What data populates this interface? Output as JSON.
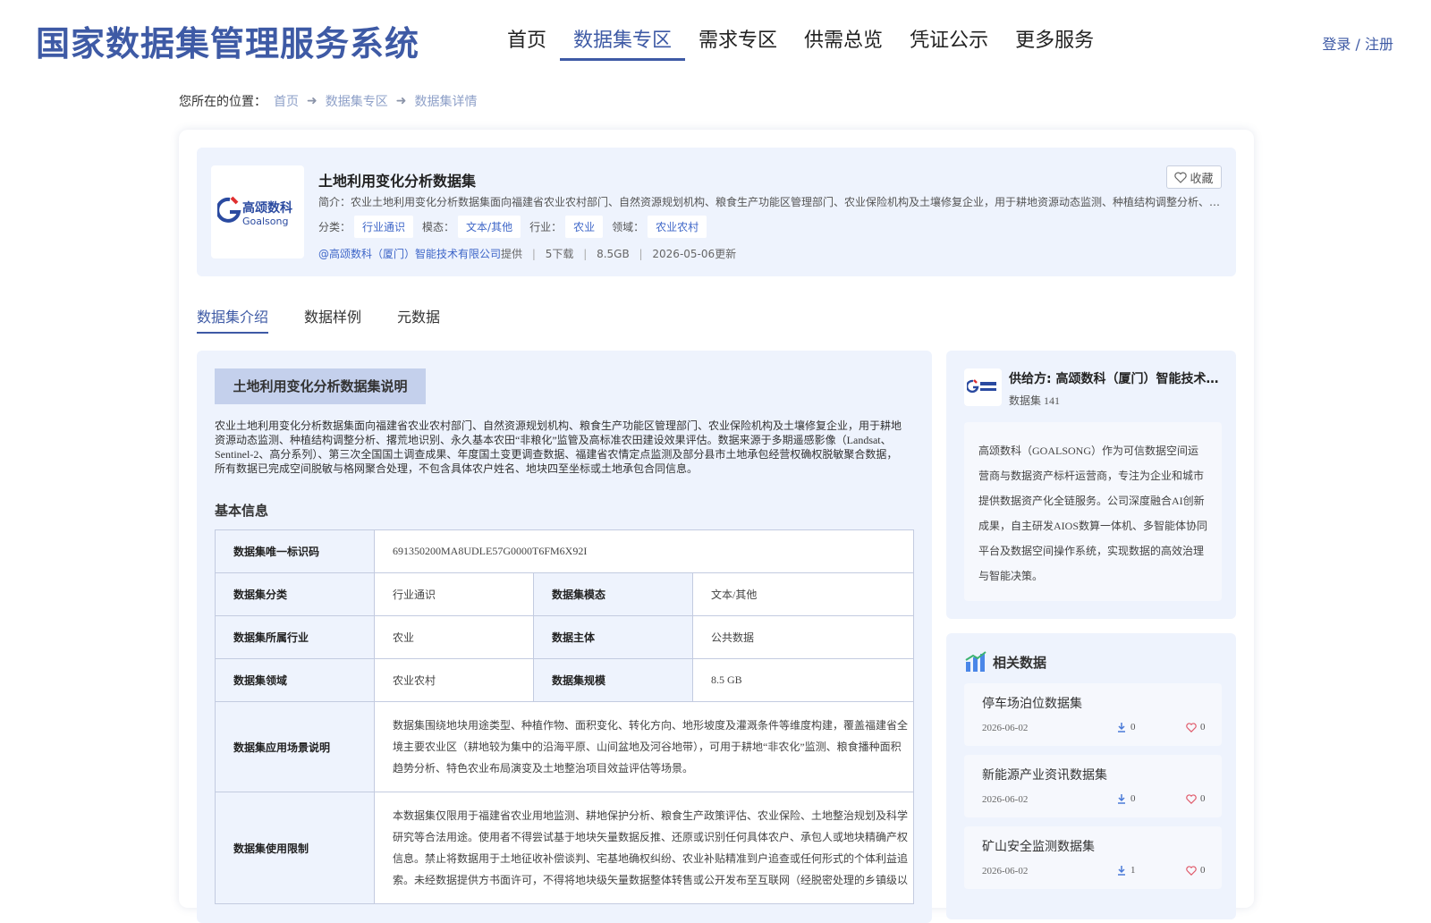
{
  "header": {
    "site_title": "国家数据集管理服务系统",
    "nav": [
      "首页",
      "数据集专区",
      "需求专区",
      "供需总览",
      "凭证公示",
      "更多服务"
    ],
    "login": "登录 / 注册"
  },
  "breadcrumb": {
    "prefix": "您所在的位置：",
    "items": [
      "首页",
      "数据集专区",
      "数据集详情"
    ]
  },
  "dataset": {
    "title": "土地利用变化分析数据集",
    "summary": "简介：农业土地利用变化分析数据集面向福建省农业农村部门、自然资源规划机构、粮食生产功能区管理部门、农业保险机构及土壤修复企业，用于耕地资源动态监测、种植结构调整分析、撂荒地识别、永久基本农田“非粮化”监管及高标准农田建设效果评估。",
    "tags": [
      {
        "label": "分类：",
        "value": "行业通识"
      },
      {
        "label": "模态：",
        "value": "文本/其他"
      },
      {
        "label": "行业：",
        "value": "农业"
      },
      {
        "label": "领域：",
        "value": "农业农村"
      }
    ],
    "provider": "@高颂数科（厦门）智能技术有限公司",
    "provider_suffix": "提供",
    "downloads": "5下载",
    "size": "8.5GB",
    "updated": "2026-05-06更新",
    "favorite": "收藏",
    "logo_cn": "高颂数科",
    "logo_en": "Goalsong"
  },
  "tabs": [
    "数据集介绍",
    "数据样例",
    "元数据"
  ],
  "intro": {
    "section_title": "土地利用变化分析数据集说明",
    "description": "农业土地利用变化分析数据集面向福建省农业农村部门、自然资源规划机构、粮食生产功能区管理部门、农业保险机构及土壤修复企业，用于耕地资源动态监测、种植结构调整分析、撂荒地识别、永久基本农田“非粮化”监管及高标准农田建设效果评估。数据来源于多期遥感影像（Landsat、Sentinel-2、高分系列）、第三次全国国土调查成果、年度国土变更调查数据、福建省农情定点监测及部分县市土地承包经营权确权脱敏聚合数据，所有数据已完成空间脱敏与格网聚合处理，不包含具体农户姓名、地块四至坐标或土地承包合同信息。",
    "basic_title": "基本信息",
    "rows": {
      "id_label": "数据集唯一标识码",
      "id_value": "691350200MA8UDLE57G0000T6FM6X92I",
      "category_label": "数据集分类",
      "category_value": "行业通识",
      "modality_label": "数据集模态",
      "modality_value": "文本/其他",
      "industry_label": "数据集所属行业",
      "industry_value": "农业",
      "subject_label": "数据主体",
      "subject_value": "公共数据",
      "domain_label": "数据集领域",
      "domain_value": "农业农村",
      "scale_label": "数据集规模",
      "scale_value": "8.5 GB",
      "scenario_label": "数据集应用场景说明",
      "scenario_value": "数据集围绕地块用途类型、种植作物、面积变化、转化方向、地形坡度及灌溉条件等维度构建，覆盖福建省全境主要农业区（耕地较为集中的沿海平原、山间盆地及河谷地带），可用于耕地“非农化”监测、粮食播种面积趋势分析、特色农业布局演变及土地整治项目效益评估等场景。",
      "limit_label": "数据集使用限制",
      "limit_value": "本数据集仅限用于福建省农业用地监测、耕地保护分析、粮食生产政策评估、农业保险、土地整治规划及科学研究等合法用途。使用者不得尝试基于地块矢量数据反推、还原或识别任何具体农户、承包人或地块精确产权信息。禁止将数据用于土地征收补偿谈判、宅基地确权纠纷、农业补贴精准到户追查或任何形式的个体利益追索。未经数据提供方书面许可，不得将地块级矢量数据整体转售或公开发布至互联网（经脱密处理的乡镇级以"
    }
  },
  "sidebar": {
    "provider": "供给方: 高颂数科（厦门）智能技术有限公司",
    "dataset_count": "数据集 141",
    "intro": "高颂数科（GOALSONG）作为可信数据空间运营商与数据资产标杆运营商，专注为企业和城市提供数据资产化全链服务。公司深度融合AI创新成果，自主研发AIOS数算一体机、多智能体协同平台及数据空间操作系统，实现数据的高效治理与智能决策。",
    "related_title": "相关数据",
    "related": [
      {
        "name": "停车场泊位数据集",
        "date": "2026-06-02",
        "downloads": "0",
        "likes": "0"
      },
      {
        "name": "新能源产业资讯数据集",
        "date": "2026-06-02",
        "downloads": "0",
        "likes": "0"
      },
      {
        "name": "矿山安全监测数据集",
        "date": "2026-06-02",
        "downloads": "1",
        "likes": "0"
      }
    ]
  },
  "colors": {
    "brand": "#3e5aa5",
    "panel": "#eef3fd",
    "link": "#3e66c8",
    "like": "#e05a6a"
  }
}
